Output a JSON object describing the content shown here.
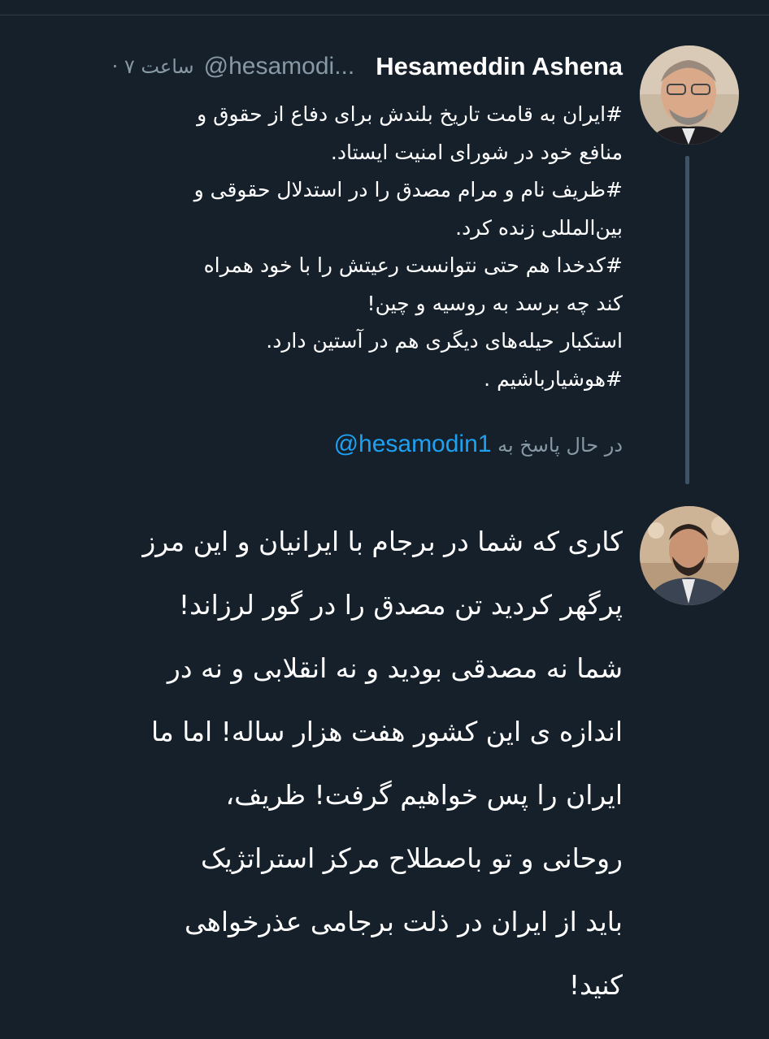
{
  "tweet": {
    "author_name": "Hesameddin Ashena",
    "handle": "@hesamodi...",
    "time_ago": "· ۷ ساعت",
    "lines": [
      "#ایران به قامت تاریخ بلندش  برای دفاع از حقوق و",
      "منافع  خود در شورای امنیت ایستاد.",
      "#ظریف نام و مرام مصدق را در استدلال حقوقی و",
      "بین‌المللی زنده کرد.",
      "#کدخدا  هم  حتی نتوانست رعیتش را با  خود همراه",
      "کند چه برسد به روسیه و چین!",
      " استکبار حیله‌های دیگری هم در آستین دارد.",
      "#هوشیارباشیم ."
    ]
  },
  "reply_context": {
    "prefix": "در حال پاسخ به",
    "handle": "@hesamodin1"
  },
  "reply": {
    "lines": [
      "کاری که شما در برجام با ایرانیان و این مرز",
      "پرگهر کردید تن مصدق را در گور لرزاند!",
      "شما نه مصدقی بودید و نه انقلابی و نه در",
      "اندازه ی این کشور هفت هزار ساله! اما ما",
      "ایران را پس خواهیم گرفت! ظریف،",
      "روحانی و تو باصطلاح مرکز استراتژیک",
      "باید از ایران در ذلت برجامی عذرخواهی",
      "کنید!"
    ]
  },
  "colors": {
    "background": "#15202b",
    "secondary_text": "#8899a6",
    "link": "#1da1f2",
    "thread_line": "#3d5466"
  },
  "icons": {
    "author_avatar": "author-avatar-photo",
    "reply_avatar": "reply-avatar-photo"
  }
}
